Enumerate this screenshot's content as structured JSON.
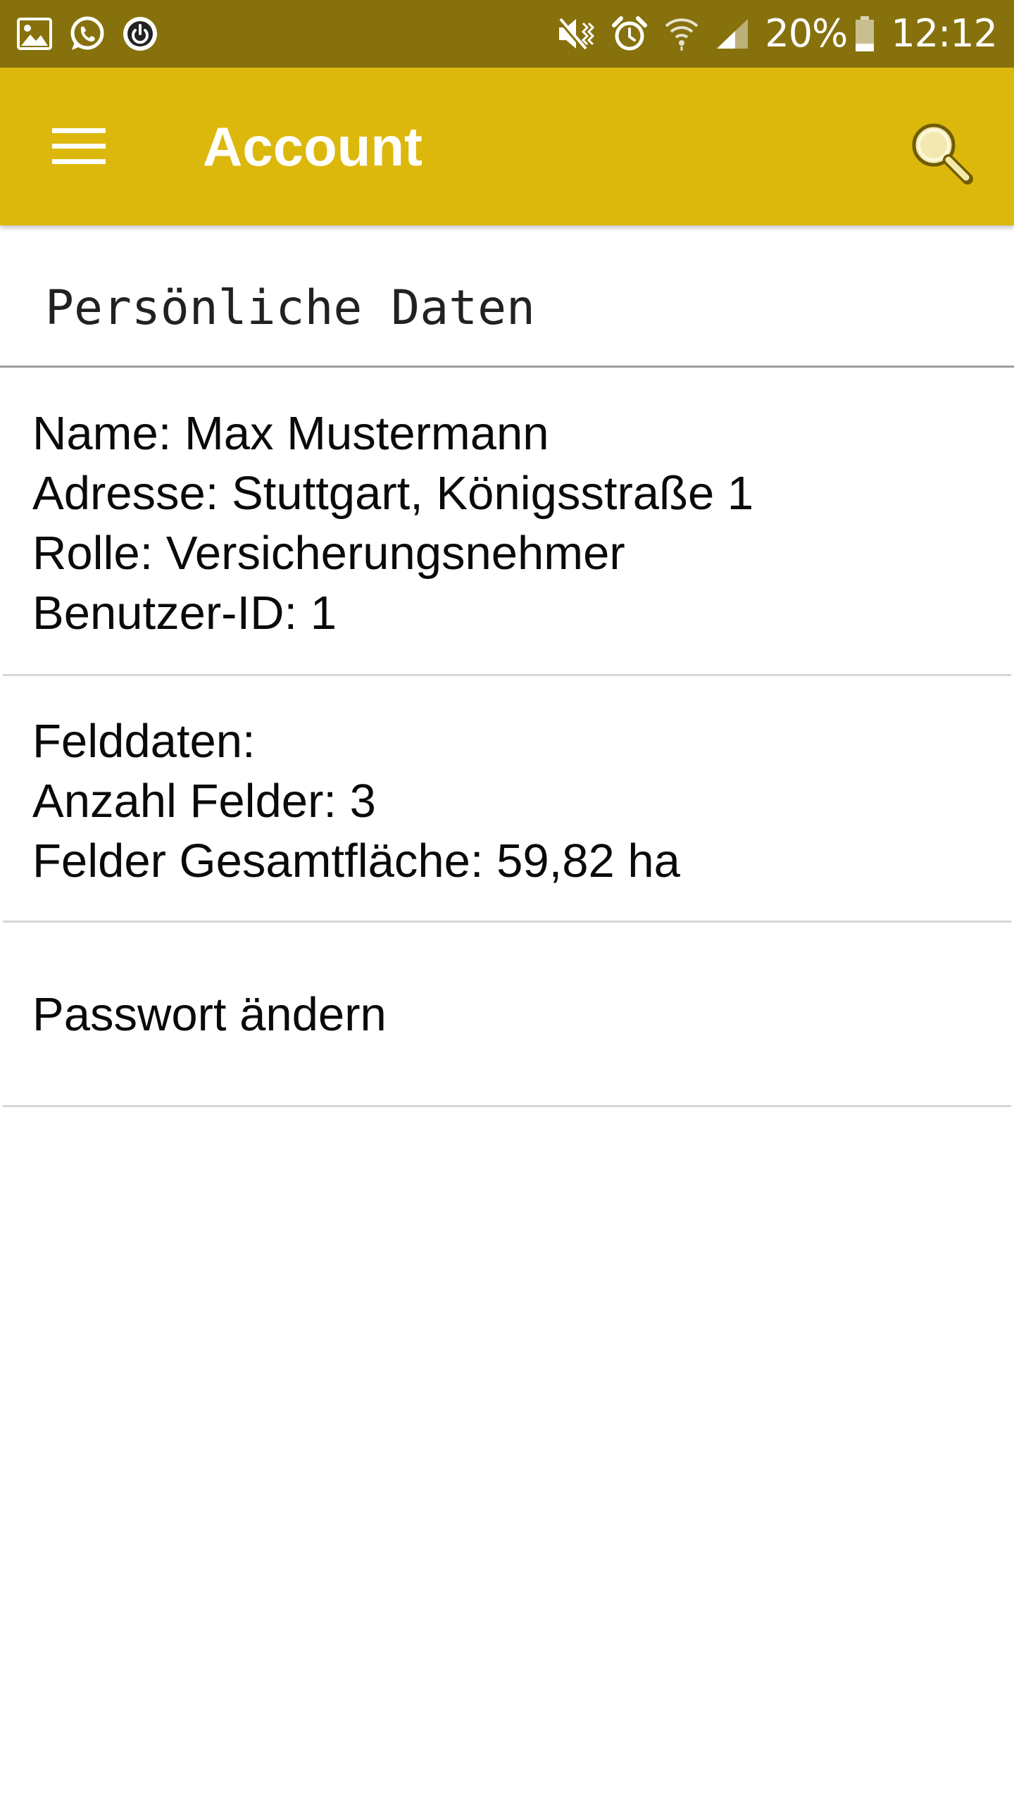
{
  "status_bar": {
    "battery": "20%",
    "time": "12:12",
    "left_icons": [
      "gallery-icon",
      "whatsapp-icon",
      "power-app-icon"
    ],
    "right_icons": [
      "mute-icon",
      "alarm-icon",
      "wifi-icon",
      "signal-icon",
      "battery-icon"
    ]
  },
  "app_bar": {
    "title": "Account",
    "background_color": "#dcb80c",
    "status_bar_color": "#86710c",
    "menu_icon": "menu-icon",
    "search_icon": "search-icon"
  },
  "section": {
    "title": "Persönliche Daten"
  },
  "personal": {
    "name": "Name: Max Mustermann",
    "address": "Adresse: Stuttgart, Königsstraße 1",
    "role": "Rolle: Versicherungsnehmer",
    "user_id": "Benutzer-ID: 1"
  },
  "fields": {
    "heading": "Felddaten:",
    "count": "Anzahl Felder: 3",
    "area": "Felder Gesamtfläche: 59,82 ha"
  },
  "password": {
    "label": "Passwort ändern"
  }
}
